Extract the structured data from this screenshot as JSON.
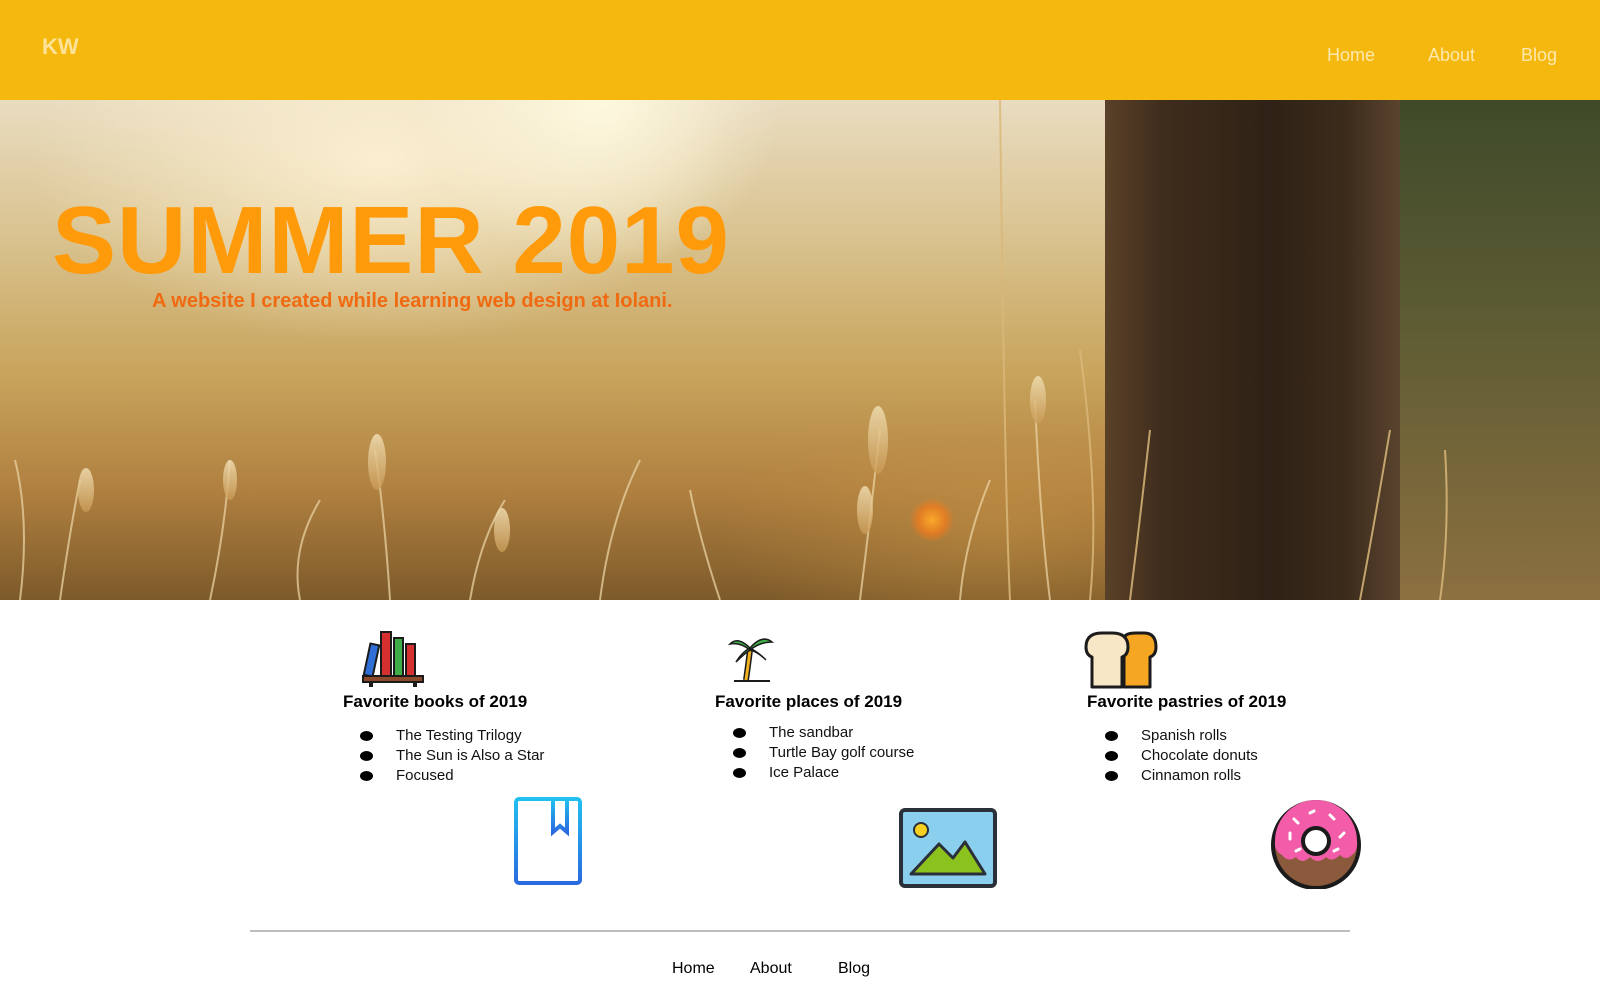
{
  "header": {
    "logo": "KW",
    "nav": [
      "Home",
      "About",
      "Blog"
    ]
  },
  "hero": {
    "title": "SUMMER 2019",
    "subtitle": "A website I created while learning web design at Iolani."
  },
  "columns": [
    {
      "heading": "Favorite books of 2019",
      "items": [
        "The Testing Trilogy",
        "The Sun is Also a Star",
        "Focused"
      ],
      "icons": [
        "bookshelf-icon",
        "bookmark-book-icon"
      ]
    },
    {
      "heading": "Favorite places of 2019",
      "items": [
        "The sandbar",
        "Turtle Bay golf course",
        "Ice Palace"
      ],
      "icons": [
        "palm-tree-icon",
        "landscape-image-icon"
      ]
    },
    {
      "heading": "Favorite pastries of 2019",
      "items": [
        "Spanish rolls",
        "Chocolate donuts",
        "Cinnamon rolls"
      ],
      "icons": [
        "bread-loaf-icon",
        "donut-icon"
      ]
    }
  ],
  "footer": {
    "nav": [
      "Home",
      "About",
      "Blog"
    ]
  },
  "colors": {
    "topbar": "#f5b80e",
    "title": "#ff9a0a",
    "subtitle": "#f06a12"
  }
}
